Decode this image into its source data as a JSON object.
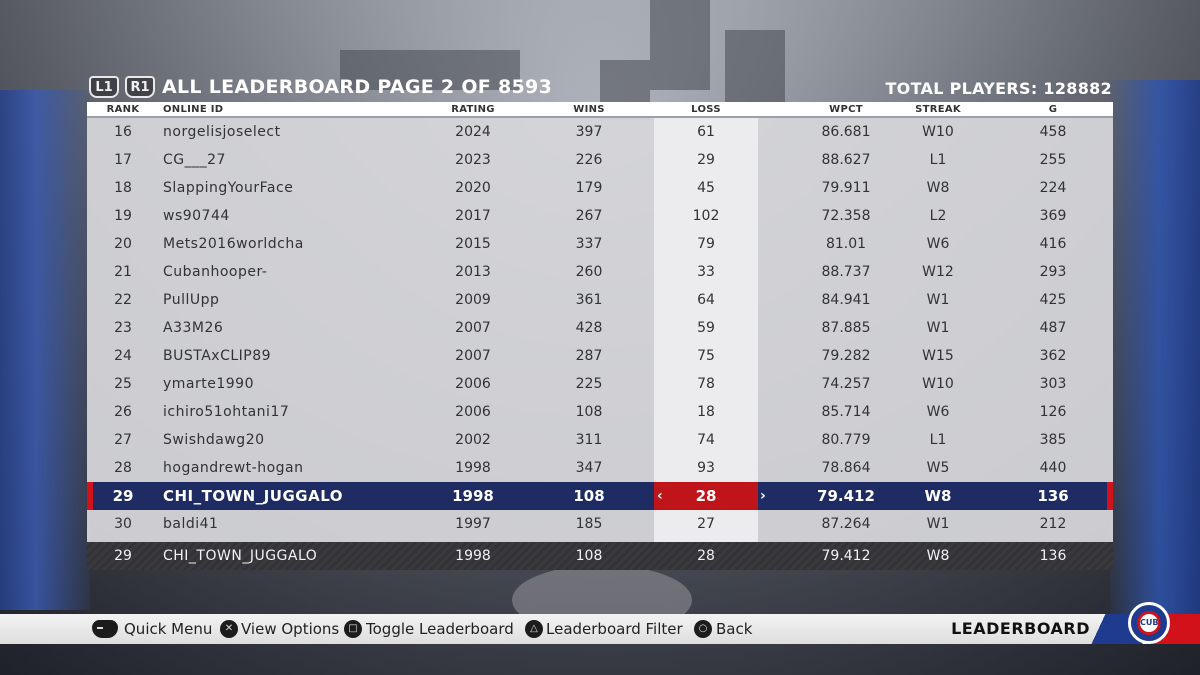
{
  "header": {
    "l1_label": "L1",
    "r1_label": "R1",
    "title": "ALL LEADERBOARD PAGE 2 OF 8593",
    "total_players": "TOTAL PLAYERS: 128882"
  },
  "columns": [
    "RANK",
    "ONLINE ID",
    "RATING",
    "WINS",
    "LOSS",
    "WPCT",
    "STREAK",
    "G"
  ],
  "rows": [
    {
      "rank": "16",
      "id": "norgelisjoselect",
      "rating": "2024",
      "wins": "397",
      "loss": "61",
      "wpct": "86.681",
      "streak": "W10",
      "g": "458"
    },
    {
      "rank": "17",
      "id": "CG___27",
      "rating": "2023",
      "wins": "226",
      "loss": "29",
      "wpct": "88.627",
      "streak": "L1",
      "g": "255"
    },
    {
      "rank": "18",
      "id": "SlappingYourFace",
      "rating": "2020",
      "wins": "179",
      "loss": "45",
      "wpct": "79.911",
      "streak": "W8",
      "g": "224"
    },
    {
      "rank": "19",
      "id": "ws90744",
      "rating": "2017",
      "wins": "267",
      "loss": "102",
      "wpct": "72.358",
      "streak": "L2",
      "g": "369"
    },
    {
      "rank": "20",
      "id": "Mets2016worldcha",
      "rating": "2015",
      "wins": "337",
      "loss": "79",
      "wpct": "81.01",
      "streak": "W6",
      "g": "416"
    },
    {
      "rank": "21",
      "id": "Cubanhooper-",
      "rating": "2013",
      "wins": "260",
      "loss": "33",
      "wpct": "88.737",
      "streak": "W12",
      "g": "293"
    },
    {
      "rank": "22",
      "id": "PullUpp",
      "rating": "2009",
      "wins": "361",
      "loss": "64",
      "wpct": "84.941",
      "streak": "W1",
      "g": "425"
    },
    {
      "rank": "23",
      "id": "A33M26",
      "rating": "2007",
      "wins": "428",
      "loss": "59",
      "wpct": "87.885",
      "streak": "W1",
      "g": "487"
    },
    {
      "rank": "24",
      "id": "BUSTAxCLIP89",
      "rating": "2007",
      "wins": "287",
      "loss": "75",
      "wpct": "79.282",
      "streak": "W15",
      "g": "362"
    },
    {
      "rank": "25",
      "id": "ymarte1990",
      "rating": "2006",
      "wins": "225",
      "loss": "78",
      "wpct": "74.257",
      "streak": "W10",
      "g": "303"
    },
    {
      "rank": "26",
      "id": "ichiro51ohtani17",
      "rating": "2006",
      "wins": "108",
      "loss": "18",
      "wpct": "85.714",
      "streak": "W6",
      "g": "126"
    },
    {
      "rank": "27",
      "id": "Swishdawg20",
      "rating": "2002",
      "wins": "311",
      "loss": "74",
      "wpct": "80.779",
      "streak": "L1",
      "g": "385"
    },
    {
      "rank": "28",
      "id": "hogandrewt-hogan",
      "rating": "1998",
      "wins": "347",
      "loss": "93",
      "wpct": "78.864",
      "streak": "W5",
      "g": "440"
    },
    {
      "rank": "29",
      "id": "CHI_TOWN_JUGGALO",
      "rating": "1998",
      "wins": "108",
      "loss": "28",
      "wpct": "79.412",
      "streak": "W8",
      "g": "136"
    },
    {
      "rank": "30",
      "id": "baldi41",
      "rating": "1997",
      "wins": "185",
      "loss": "27",
      "wpct": "87.264",
      "streak": "W1",
      "g": "212"
    }
  ],
  "selected_row_index": 13,
  "my_row": {
    "rank": "29",
    "id": "CHI_TOWN_JUGGALO",
    "rating": "1998",
    "wins": "108",
    "loss": "28",
    "wpct": "79.412",
    "streak": "W8",
    "g": "136"
  },
  "footer": {
    "quick_menu": "Quick Menu",
    "view_options": "View Options",
    "toggle_leaderboard": "Toggle Leaderboard",
    "leaderboard_filter": "Leaderboard Filter",
    "back": "Back",
    "screen_label": "LEADERBOARD"
  },
  "icons": {
    "quick_menu": "gamepad-icon",
    "view_options": "cross-button-icon",
    "toggle_leaderboard": "square-button-icon",
    "leaderboard_filter": "triangle-button-icon",
    "back": "circle-button-icon",
    "team_logo": "cubs-logo-icon"
  },
  "logo_text": "CUBS",
  "colors": {
    "selected_row_bg": "#1f2b63",
    "selected_accent": "#c0141b",
    "team_blue": "#1e3b8f"
  }
}
